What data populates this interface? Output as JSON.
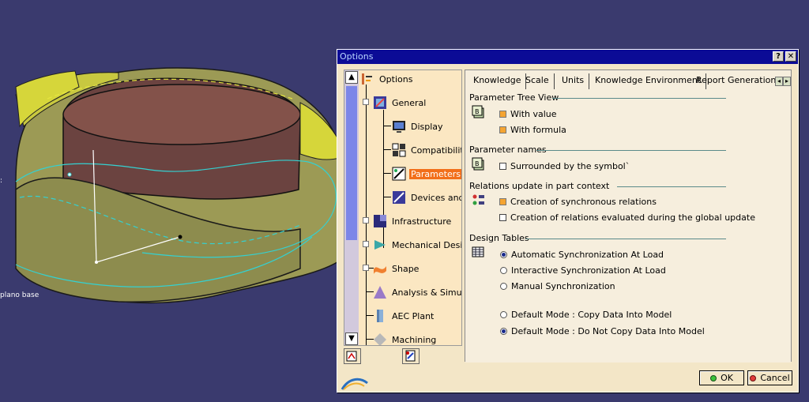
{
  "viewport": {
    "labels": {
      "plano_base": "plano base"
    }
  },
  "dialog": {
    "title": "Options",
    "help_label": "?",
    "close_label": "✕",
    "ok_label": "OK",
    "cancel_label": "Cancel"
  },
  "tree": {
    "scroll_up": "▲",
    "scroll_down": "▼",
    "items": [
      {
        "label": "Options",
        "icon": "options-icon"
      },
      {
        "label": "General",
        "icon": "general-icon"
      },
      {
        "label": "Display",
        "icon": "display-icon"
      },
      {
        "label": "Compatibility",
        "icon": "compatibility-icon"
      },
      {
        "label": "Parameters and Measure",
        "icon": "parameters-icon"
      },
      {
        "label": "Devices and Virtual Reality",
        "icon": "devices-icon"
      },
      {
        "label": "Infrastructure",
        "icon": "infrastructure-icon"
      },
      {
        "label": "Mechanical Design",
        "icon": "mechanical-icon"
      },
      {
        "label": "Shape",
        "icon": "shape-icon"
      },
      {
        "label": "Analysis & Simulation",
        "icon": "analysis-icon"
      },
      {
        "label": "AEC Plant",
        "icon": "aec-icon"
      },
      {
        "label": "Machining",
        "icon": "machining-icon"
      }
    ]
  },
  "tabs": {
    "items": [
      "Knowledge",
      "Scale",
      "Units",
      "Knowledge Environment",
      "Report Generation"
    ],
    "active": "Knowledge"
  },
  "knowledge": {
    "param_tree_view": {
      "title": "Parameter Tree View",
      "with_value": "With value",
      "with_formula": "With formula"
    },
    "param_names": {
      "title": "Parameter names",
      "surrounded": "Surrounded by the symbol`"
    },
    "relations": {
      "title": "Relations update in part context",
      "synchronous": "Creation of synchronous relations",
      "evaluated": "Creation of relations evaluated during the global update"
    },
    "design_tables": {
      "title": "Design Tables",
      "auto_sync": "Automatic Synchronization At Load",
      "interactive_sync": "Interactive Synchronization At Load",
      "manual_sync": "Manual Synchronization",
      "copy_mode": "Default Mode : Copy Data Into Model",
      "no_copy_mode": "Default Mode : Do Not Copy Data Into Model"
    }
  }
}
